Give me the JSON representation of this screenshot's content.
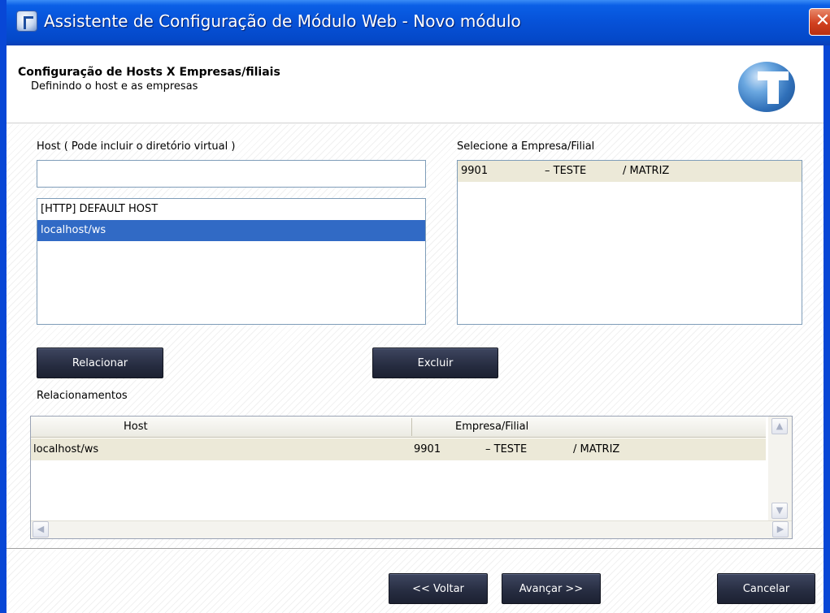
{
  "window": {
    "title": "Assistente de Configuração de Módulo Web - Novo módulo",
    "close_symbol": "✕"
  },
  "header": {
    "title": "Configuração de Hosts X Empresas/filiais",
    "subtitle": "Definindo o host e as empresas"
  },
  "host": {
    "label": "Host ( Pode incluir o diretório virtual )",
    "input_value": "",
    "items": [
      "[HTTP] DEFAULT HOST",
      "localhost/ws"
    ],
    "selected_index": 1
  },
  "empresa": {
    "label": "Selecione a Empresa/Filial",
    "rows": [
      {
        "code": "9901",
        "name": "– TESTE",
        "filial": "/ MATRIZ"
      }
    ]
  },
  "buttons": {
    "relacionar": "Relacionar",
    "excluir": "Excluir",
    "voltar": "<< Voltar",
    "avancar": "Avançar >>",
    "cancelar": "Cancelar"
  },
  "relacionamentos": {
    "label": "Relacionamentos",
    "columns": [
      "Host",
      "Empresa/Filial"
    ],
    "rows": [
      {
        "host": "localhost/ws",
        "code": "9901",
        "name": "– TESTE",
        "filial": "/ MATRIZ"
      }
    ]
  },
  "icons": {
    "app": "totvs-app-icon",
    "logo": "totvs-logo",
    "scroll_up": "▲",
    "scroll_down": "▼",
    "scroll_left": "◀",
    "scroll_right": "▶"
  },
  "colors": {
    "title_bar": "#0651d7",
    "selection": "#316ac5",
    "dark_button": "#262c40",
    "row_highlight": "#ece9d8"
  }
}
